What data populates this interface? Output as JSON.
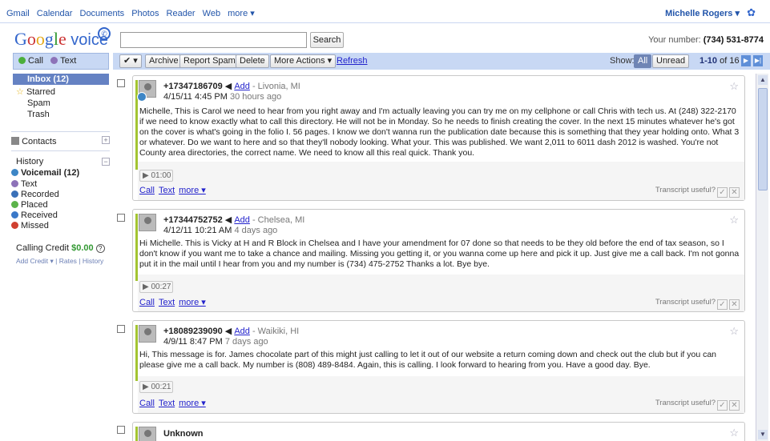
{
  "topnav": [
    "Gmail",
    "Calendar",
    "Documents",
    "Photos",
    "Reader",
    "Web",
    "more ▾"
  ],
  "user": "Michelle Rogers ▾",
  "logo": {
    "google": [
      "G",
      "o",
      "o",
      "g",
      "l",
      "e"
    ],
    "voice": "voice"
  },
  "search": {
    "value": "",
    "button": "Search"
  },
  "your_number": {
    "label": "Your number:",
    "value": "(734) 531-8774"
  },
  "call_label": "Call",
  "text_label": "Text",
  "toolbar": {
    "check": "✔ ▾",
    "archive": "Archive",
    "report_spam": "Report Spam",
    "delete": "Delete",
    "more_actions": "More Actions ▾",
    "refresh": "Refresh",
    "show_label": "Show:",
    "show_all": "All",
    "show_unread": "Unread",
    "range": "1-10",
    "of": "of 16"
  },
  "sidebar": {
    "inbox": "Inbox (12)",
    "starred": "Starred",
    "spam": "Spam",
    "trash": "Trash",
    "contacts": "Contacts",
    "history": "History",
    "voicemail": "Voicemail (12)",
    "text": "Text",
    "recorded": "Recorded",
    "placed": "Placed",
    "received": "Received",
    "missed": "Missed",
    "credit_label": "Calling Credit",
    "credit_value": "$0.00",
    "links": "Add Credit ▾ | Rates | History"
  },
  "messages": [
    {
      "number": "+17347186709",
      "add": "Add",
      "location": "- Livonia, MI",
      "date": "4/15/11 4:45 PM",
      "ago": "30 hours ago",
      "transcript": "Michelle, This is Carol we need to hear from you right away and I'm actually leaving you can try me on my cellphone or call Chris with tech us. At (248) 322-2170 if we need to know exactly what to call this directory. He will not be in Monday. So he needs to finish creating the cover. In the next 15 minutes whatever he's got on the cover is what's going in the folio I. 56 pages. I know we don't wanna run the publication date because this is something that they year holding onto. What 3 or whatever. Do we want to here and so that they'll nobody looking. What your. This was published. We want 2,011 to 6011 dash 2012 is washed. You're not County area directories, the correct name. We need to know all this real quick. Thank you.",
      "duration": "01:00"
    },
    {
      "number": "+17344752752",
      "add": "Add",
      "location": "- Chelsea, MI",
      "date": "4/12/11 10:21 AM",
      "ago": "4 days ago",
      "transcript": "Hi Michelle. This is Vicky at H and R Block in Chelsea and I have your amendment for 07 done so that needs to be they old before the end of tax season, so I don't know if you want me to take a chance and mailing. Missing you getting it, or you wanna come up here and pick it up. Just give me a call back. I'm not gonna put it in the mail until I hear from you and my number is (734) 475-2752 Thanks a lot. Bye bye.",
      "duration": "00:27"
    },
    {
      "number": "+18089239090",
      "add": "Add",
      "location": "- Waikiki, HI",
      "date": "4/9/11 8:47 PM",
      "ago": "7 days ago",
      "transcript": "Hi, This message is for. James chocolate part of this might just calling to let it out of our website a return coming down and check out the club but if you can please give me a call back. My number is (808) 489-8484. Again, this is calling. I look forward to hearing from you. Have a good day. Bye.",
      "duration": "00:21"
    },
    {
      "number": "Unknown"
    }
  ],
  "msg_actions": {
    "call": "Call",
    "text": "Text",
    "more": "more ▾",
    "useful": "Transcript useful?"
  }
}
